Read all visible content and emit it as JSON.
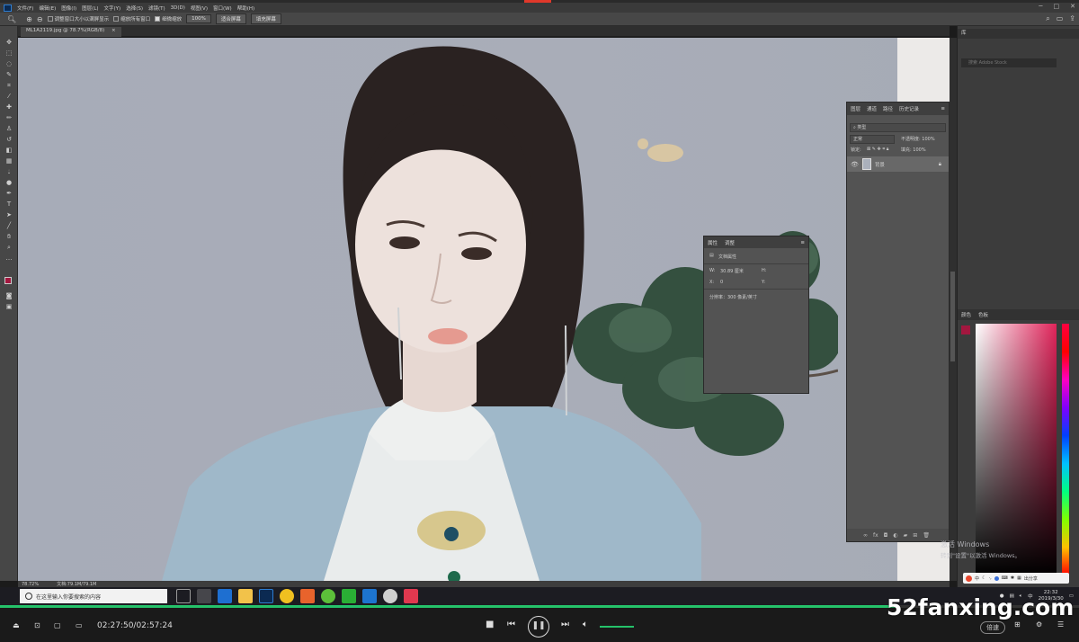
{
  "app": {
    "title": "Adobe Photoshop"
  },
  "menubar": {
    "items": [
      "文件(F)",
      "编辑(E)",
      "图像(I)",
      "图层(L)",
      "文字(Y)",
      "选择(S)",
      "滤镜(T)",
      "3D(D)",
      "视图(V)",
      "窗口(W)",
      "帮助(H)"
    ]
  },
  "options_bar": {
    "resize_windows_label": "调整窗口大小以满屏显示",
    "zoom_all_label": "缩放所有窗口",
    "scrubby_zoom_label": "细微缩放",
    "zoom_value": "100%",
    "fit_screen_label": "适合屏幕",
    "fill_screen_label": "填充屏幕",
    "resize_windows_checked": false,
    "zoom_all_checked": false,
    "scrubby_zoom_checked": true
  },
  "document_tab": {
    "label": "ML1A2119.jpg @ 78.7%(RGB/8)",
    "close": "×"
  },
  "status_bar": {
    "zoom": "78.72%",
    "doc_size": "文档:79.1M/79.1M"
  },
  "properties_panel": {
    "tabs": [
      "属性",
      "调整"
    ],
    "title": "文档属性",
    "w_label": "W:",
    "w_value": "30.89 厘米",
    "h_label": "H:",
    "x_label": "X:",
    "x_value": "0",
    "y_label": "Y:",
    "resolution": "分辨率：300 像素/英寸"
  },
  "layers_panel": {
    "tabs": [
      "图层",
      "通道",
      "路径",
      "历史记录"
    ],
    "filter_kind": "类型",
    "blend_mode": "正常",
    "opacity_label": "不透明度:",
    "opacity_value": "100%",
    "lock_label": "锁定:",
    "fill_label": "填充:",
    "fill_value": "100%",
    "layer_name": "背景"
  },
  "right_dock": {
    "library_tab": "库",
    "library_search_placeholder": "搜索 Adobe Stock",
    "color_tabs": [
      "颜色",
      "色板"
    ]
  },
  "colors": {
    "foreground": "#a3173f",
    "background": "#ffffff",
    "accent_green": "#25c26a"
  },
  "activation": {
    "title": "激活 Windows",
    "subtitle": "转到\"设置\"以激活 Windows。"
  },
  "ime_bar": {
    "label": "中",
    "share": "出分享"
  },
  "taskbar": {
    "search_placeholder": "在这里输入你要搜索的内容",
    "clock_time": "22:32",
    "clock_date": "2019/3/30"
  },
  "player": {
    "time": "02:27:50/02:57:24",
    "progress_fraction": 0.832,
    "speed_label": "倍速",
    "watermark": "52fanxing.com"
  }
}
